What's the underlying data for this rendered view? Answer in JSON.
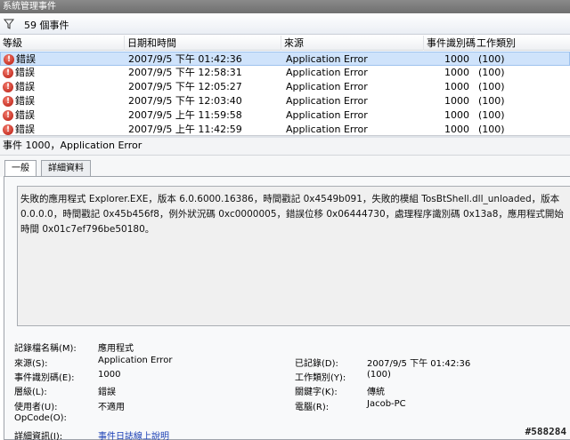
{
  "window": {
    "title": "系統管理事件"
  },
  "filter": {
    "count_label": "59 個事件"
  },
  "grid": {
    "columns": [
      "等級",
      "日期和時間",
      "來源",
      "事件識別碼",
      "工作類別"
    ],
    "rows": [
      {
        "level": "錯誤",
        "datetime": "2007/9/5 下午 01:42:36",
        "source": "Application Error",
        "event_id": "1000",
        "category": "(100)"
      },
      {
        "level": "錯誤",
        "datetime": "2007/9/5 下午 12:58:31",
        "source": "Application Error",
        "event_id": "1000",
        "category": "(100)"
      },
      {
        "level": "錯誤",
        "datetime": "2007/9/5 下午 12:05:27",
        "source": "Application Error",
        "event_id": "1000",
        "category": "(100)"
      },
      {
        "level": "錯誤",
        "datetime": "2007/9/5 下午 12:03:40",
        "source": "Application Error",
        "event_id": "1000",
        "category": "(100)"
      },
      {
        "level": "錯誤",
        "datetime": "2007/9/5 上午 11:59:58",
        "source": "Application Error",
        "event_id": "1000",
        "category": "(100)"
      },
      {
        "level": "錯誤",
        "datetime": "2007/9/5 上午 11:42:59",
        "source": "Application Error",
        "event_id": "1000",
        "category": "(100)"
      }
    ]
  },
  "detail": {
    "title": "事件 1000，Application Error",
    "tabs": [
      "一般",
      "詳細資料"
    ],
    "description": "失敗的應用程式 Explorer.EXE，版本 6.0.6000.16386，時間戳記 0x4549b091，失敗的模組 TosBtShell.dll_unloaded，版本 0.0.0.0，時間戳記 0x45b456f8，例外狀況碼 0xc0000005，錯誤位移 0x06444730，處理程序識別碼 0x13a8，應用程式開始時間 0x01c7ef796be50180。",
    "props": {
      "log_name_label": "記錄檔名稱(M):",
      "log_name_value": "應用程式",
      "source_label": "來源(S):",
      "source_value": "Application Error",
      "logged_label": "已記錄(D):",
      "logged_value": "2007/9/5 下午 01:42:36",
      "event_id_label": "事件識別碼(E):",
      "event_id_value": "1000",
      "task_label": "工作類別(Y):",
      "task_value": "(100)",
      "level_label": "層級(L):",
      "level_value": "錯誤",
      "keywords_label": "關鍵字(K):",
      "keywords_value": "傳統",
      "user_label": "使用者(U):",
      "user_value": "不適用",
      "computer_label": "電腦(R):",
      "computer_value": "Jacob-PC",
      "opcode_label": "OpCode(O):",
      "more_info_label": "詳細資訊(I):",
      "more_info_link": "事件日誌線上說明"
    }
  },
  "watermark": "#588284"
}
